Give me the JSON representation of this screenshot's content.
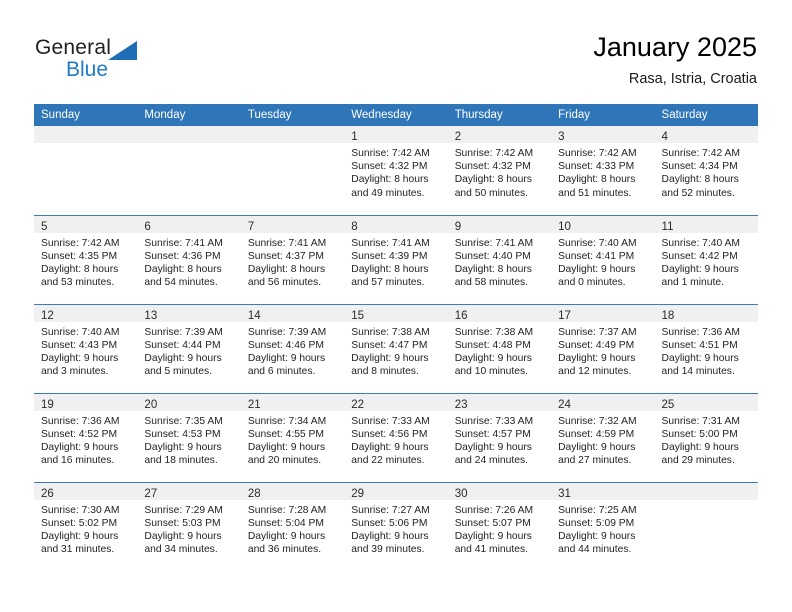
{
  "brand": {
    "name_part1": "General",
    "name_part2": "Blue",
    "triangle_icon": "triangle-icon",
    "color_dark": "#231f20",
    "color_blue": "#1f7ac4"
  },
  "header": {
    "title": "January 2025",
    "subtitle": "Rasa, Istria, Croatia"
  },
  "colors": {
    "header_row_bg": "#2f76b8",
    "daynum_band_bg": "#f0f0f0",
    "row_divider": "#3a7cbd"
  },
  "weekday_headers": [
    "Sunday",
    "Monday",
    "Tuesday",
    "Wednesday",
    "Thursday",
    "Friday",
    "Saturday"
  ],
  "weeks": [
    [
      {
        "day": "",
        "sunrise": "",
        "sunset": "",
        "daylight_line1": "",
        "daylight_line2": ""
      },
      {
        "day": "",
        "sunrise": "",
        "sunset": "",
        "daylight_line1": "",
        "daylight_line2": ""
      },
      {
        "day": "",
        "sunrise": "",
        "sunset": "",
        "daylight_line1": "",
        "daylight_line2": ""
      },
      {
        "day": "1",
        "sunrise": "Sunrise: 7:42 AM",
        "sunset": "Sunset: 4:32 PM",
        "daylight_line1": "Daylight: 8 hours",
        "daylight_line2": "and 49 minutes."
      },
      {
        "day": "2",
        "sunrise": "Sunrise: 7:42 AM",
        "sunset": "Sunset: 4:32 PM",
        "daylight_line1": "Daylight: 8 hours",
        "daylight_line2": "and 50 minutes."
      },
      {
        "day": "3",
        "sunrise": "Sunrise: 7:42 AM",
        "sunset": "Sunset: 4:33 PM",
        "daylight_line1": "Daylight: 8 hours",
        "daylight_line2": "and 51 minutes."
      },
      {
        "day": "4",
        "sunrise": "Sunrise: 7:42 AM",
        "sunset": "Sunset: 4:34 PM",
        "daylight_line1": "Daylight: 8 hours",
        "daylight_line2": "and 52 minutes."
      }
    ],
    [
      {
        "day": "5",
        "sunrise": "Sunrise: 7:42 AM",
        "sunset": "Sunset: 4:35 PM",
        "daylight_line1": "Daylight: 8 hours",
        "daylight_line2": "and 53 minutes."
      },
      {
        "day": "6",
        "sunrise": "Sunrise: 7:41 AM",
        "sunset": "Sunset: 4:36 PM",
        "daylight_line1": "Daylight: 8 hours",
        "daylight_line2": "and 54 minutes."
      },
      {
        "day": "7",
        "sunrise": "Sunrise: 7:41 AM",
        "sunset": "Sunset: 4:37 PM",
        "daylight_line1": "Daylight: 8 hours",
        "daylight_line2": "and 56 minutes."
      },
      {
        "day": "8",
        "sunrise": "Sunrise: 7:41 AM",
        "sunset": "Sunset: 4:39 PM",
        "daylight_line1": "Daylight: 8 hours",
        "daylight_line2": "and 57 minutes."
      },
      {
        "day": "9",
        "sunrise": "Sunrise: 7:41 AM",
        "sunset": "Sunset: 4:40 PM",
        "daylight_line1": "Daylight: 8 hours",
        "daylight_line2": "and 58 minutes."
      },
      {
        "day": "10",
        "sunrise": "Sunrise: 7:40 AM",
        "sunset": "Sunset: 4:41 PM",
        "daylight_line1": "Daylight: 9 hours",
        "daylight_line2": "and 0 minutes."
      },
      {
        "day": "11",
        "sunrise": "Sunrise: 7:40 AM",
        "sunset": "Sunset: 4:42 PM",
        "daylight_line1": "Daylight: 9 hours",
        "daylight_line2": "and 1 minute."
      }
    ],
    [
      {
        "day": "12",
        "sunrise": "Sunrise: 7:40 AM",
        "sunset": "Sunset: 4:43 PM",
        "daylight_line1": "Daylight: 9 hours",
        "daylight_line2": "and 3 minutes."
      },
      {
        "day": "13",
        "sunrise": "Sunrise: 7:39 AM",
        "sunset": "Sunset: 4:44 PM",
        "daylight_line1": "Daylight: 9 hours",
        "daylight_line2": "and 5 minutes."
      },
      {
        "day": "14",
        "sunrise": "Sunrise: 7:39 AM",
        "sunset": "Sunset: 4:46 PM",
        "daylight_line1": "Daylight: 9 hours",
        "daylight_line2": "and 6 minutes."
      },
      {
        "day": "15",
        "sunrise": "Sunrise: 7:38 AM",
        "sunset": "Sunset: 4:47 PM",
        "daylight_line1": "Daylight: 9 hours",
        "daylight_line2": "and 8 minutes."
      },
      {
        "day": "16",
        "sunrise": "Sunrise: 7:38 AM",
        "sunset": "Sunset: 4:48 PM",
        "daylight_line1": "Daylight: 9 hours",
        "daylight_line2": "and 10 minutes."
      },
      {
        "day": "17",
        "sunrise": "Sunrise: 7:37 AM",
        "sunset": "Sunset: 4:49 PM",
        "daylight_line1": "Daylight: 9 hours",
        "daylight_line2": "and 12 minutes."
      },
      {
        "day": "18",
        "sunrise": "Sunrise: 7:36 AM",
        "sunset": "Sunset: 4:51 PM",
        "daylight_line1": "Daylight: 9 hours",
        "daylight_line2": "and 14 minutes."
      }
    ],
    [
      {
        "day": "19",
        "sunrise": "Sunrise: 7:36 AM",
        "sunset": "Sunset: 4:52 PM",
        "daylight_line1": "Daylight: 9 hours",
        "daylight_line2": "and 16 minutes."
      },
      {
        "day": "20",
        "sunrise": "Sunrise: 7:35 AM",
        "sunset": "Sunset: 4:53 PM",
        "daylight_line1": "Daylight: 9 hours",
        "daylight_line2": "and 18 minutes."
      },
      {
        "day": "21",
        "sunrise": "Sunrise: 7:34 AM",
        "sunset": "Sunset: 4:55 PM",
        "daylight_line1": "Daylight: 9 hours",
        "daylight_line2": "and 20 minutes."
      },
      {
        "day": "22",
        "sunrise": "Sunrise: 7:33 AM",
        "sunset": "Sunset: 4:56 PM",
        "daylight_line1": "Daylight: 9 hours",
        "daylight_line2": "and 22 minutes."
      },
      {
        "day": "23",
        "sunrise": "Sunrise: 7:33 AM",
        "sunset": "Sunset: 4:57 PM",
        "daylight_line1": "Daylight: 9 hours",
        "daylight_line2": "and 24 minutes."
      },
      {
        "day": "24",
        "sunrise": "Sunrise: 7:32 AM",
        "sunset": "Sunset: 4:59 PM",
        "daylight_line1": "Daylight: 9 hours",
        "daylight_line2": "and 27 minutes."
      },
      {
        "day": "25",
        "sunrise": "Sunrise: 7:31 AM",
        "sunset": "Sunset: 5:00 PM",
        "daylight_line1": "Daylight: 9 hours",
        "daylight_line2": "and 29 minutes."
      }
    ],
    [
      {
        "day": "26",
        "sunrise": "Sunrise: 7:30 AM",
        "sunset": "Sunset: 5:02 PM",
        "daylight_line1": "Daylight: 9 hours",
        "daylight_line2": "and 31 minutes."
      },
      {
        "day": "27",
        "sunrise": "Sunrise: 7:29 AM",
        "sunset": "Sunset: 5:03 PM",
        "daylight_line1": "Daylight: 9 hours",
        "daylight_line2": "and 34 minutes."
      },
      {
        "day": "28",
        "sunrise": "Sunrise: 7:28 AM",
        "sunset": "Sunset: 5:04 PM",
        "daylight_line1": "Daylight: 9 hours",
        "daylight_line2": "and 36 minutes."
      },
      {
        "day": "29",
        "sunrise": "Sunrise: 7:27 AM",
        "sunset": "Sunset: 5:06 PM",
        "daylight_line1": "Daylight: 9 hours",
        "daylight_line2": "and 39 minutes."
      },
      {
        "day": "30",
        "sunrise": "Sunrise: 7:26 AM",
        "sunset": "Sunset: 5:07 PM",
        "daylight_line1": "Daylight: 9 hours",
        "daylight_line2": "and 41 minutes."
      },
      {
        "day": "31",
        "sunrise": "Sunrise: 7:25 AM",
        "sunset": "Sunset: 5:09 PM",
        "daylight_line1": "Daylight: 9 hours",
        "daylight_line2": "and 44 minutes."
      },
      {
        "day": "",
        "sunrise": "",
        "sunset": "",
        "daylight_line1": "",
        "daylight_line2": ""
      }
    ]
  ]
}
